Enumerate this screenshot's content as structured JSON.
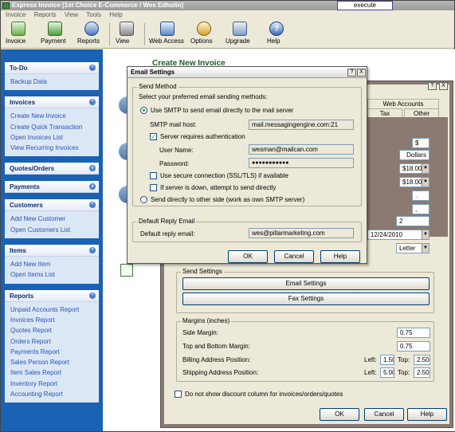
{
  "window": {
    "title": "Express Invoice [1st Choice E-Commerce / Wes Edholin]",
    "exec_label": "execute screenshot"
  },
  "menu": [
    "Invoice",
    "Reports",
    "View",
    "Tools",
    "Help"
  ],
  "toolbar": {
    "invoice": "Invoice",
    "payment": "Payment",
    "reports": "Reports",
    "view": "View",
    "web_access": "Web Access",
    "options": "Options",
    "upgrade": "Upgrade",
    "help": "Help"
  },
  "sidebar": {
    "todo": {
      "title": "To-Do",
      "items": [
        "Backup Data"
      ]
    },
    "invoices": {
      "title": "Invoices",
      "items": [
        "Create New Invoice",
        "Create Quick Transaction",
        "Open Invoices List",
        "View Recurring Invoices"
      ]
    },
    "quotes": {
      "title": "Quotes/Orders"
    },
    "payments": {
      "title": "Payments"
    },
    "customers": {
      "title": "Customers",
      "items": [
        "Add New Customer",
        "Open Customers List"
      ]
    },
    "items": {
      "title": "Items",
      "items": [
        "Add New Item",
        "Open Items List"
      ]
    },
    "reports": {
      "title": "Reports",
      "items": [
        "Unpaid Accounts Report",
        "Invoices Report",
        "Quotes Report",
        "Orders Report",
        "Payments Report",
        "Sales Person Report",
        "Item Sales Report",
        "Inventory Report",
        "Accounting Report"
      ]
    }
  },
  "background": {
    "create_title": "Create New Invoice"
  },
  "options_dialog": {
    "title_ctl_help": "?",
    "title_ctl_close": "X",
    "tabs": [
      "Web Accounts",
      "Tax",
      "Other"
    ],
    "fields": {
      "currency_symbol": "$",
      "currency_name": "Dollars",
      "price1": "$18.00",
      "price2": "$18.00",
      "dot1": ".",
      "dot2": ",",
      "number": "2",
      "date": "12/24/2010",
      "paper": "Letter"
    },
    "send_settings": {
      "legend": "Send Settings",
      "email_btn": "Email Settings",
      "fax_btn": "Fax Settings"
    },
    "margins": {
      "legend": "Margins (inches)",
      "side_label": "Side Margin:",
      "side_value": "0.75",
      "topbottom_label": "Top and Bottom Margin:",
      "topbottom_value": "0.75",
      "billing_label": "Billing Address Position:",
      "billing_left": "1.50",
      "billing_top": "2.50",
      "shipping_label": "Shipping Address Position:",
      "shipping_left": "5.00",
      "shipping_top": "2.50",
      "left_label": "Left:",
      "top_label": "Top:"
    },
    "discount_label": "Do not show discount column for invoices/orders/quotes",
    "ok": "OK",
    "cancel": "Cancel",
    "help": "Help"
  },
  "email_dialog": {
    "title": "Email Settings",
    "ctl_help": "?",
    "ctl_close": "X",
    "send_method_legend": "Send Method",
    "instruction": "Select your preferred email sending methods:",
    "use_smtp": "Use SMTP to send email directly to the mail server",
    "host_label": "SMTP mail host:",
    "host_value": "mail.messagingengine.com:21",
    "auth_label": "Server requires authentication",
    "user_label": "User Name:",
    "user_value": "wesman@mailcan.com",
    "pass_label": "Password:",
    "pass_value": "●●●●●●●●●●●",
    "ssl_label": "Use secure connection (SSL/TLS) if available",
    "down_label": "If server is down, attempt to send directly",
    "direct_label": "Send directly to other side (work as own SMTP server)",
    "reply_legend": "Default Reply Email",
    "reply_label": "Default reply email:",
    "reply_value": "wes@pillarmarketing.com",
    "ok": "OK",
    "cancel": "Cancel",
    "help": "Help"
  },
  "colors": {
    "sidebar": "#1a62b4",
    "link": "#2654b8",
    "accent": "#21a121"
  }
}
